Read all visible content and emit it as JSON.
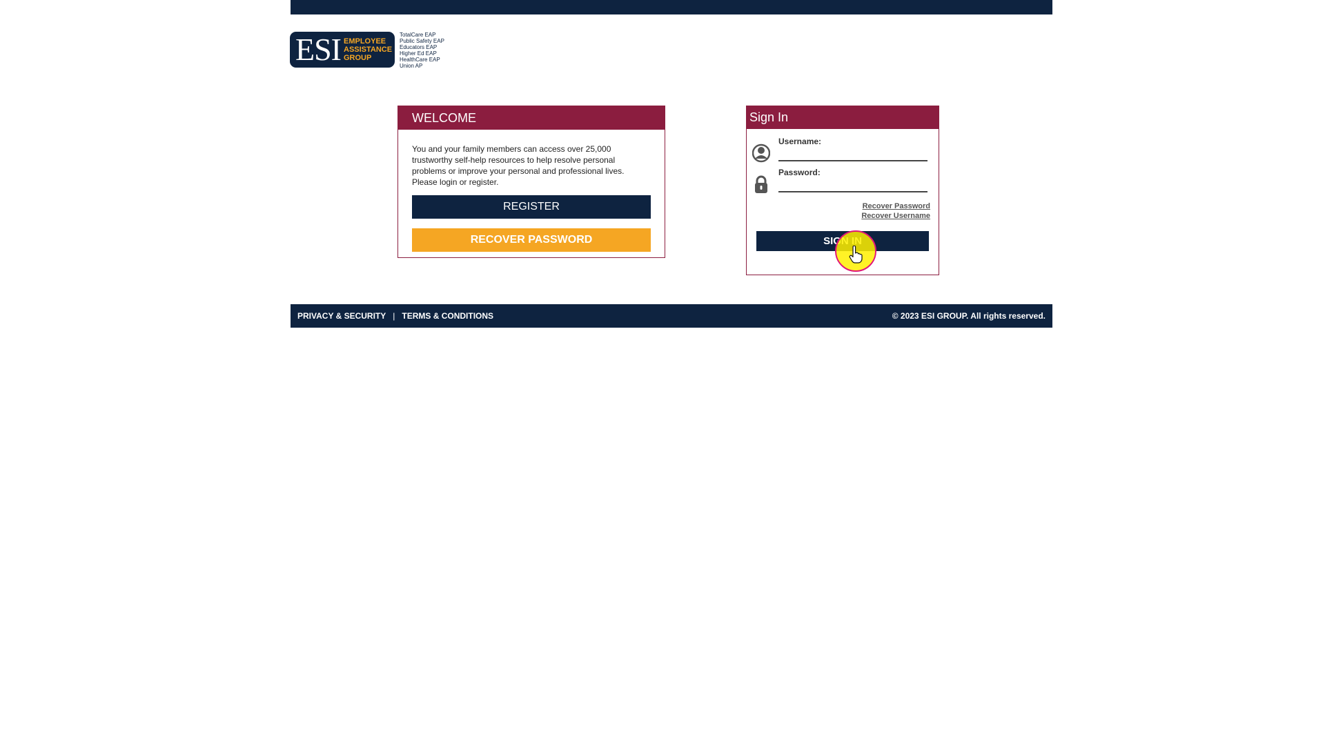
{
  "logo": {
    "main": "ESI",
    "sub_lines": [
      "EMPLOYEE",
      "ASSISTANCE",
      "GROUP"
    ],
    "programs": [
      "TotalCare EAP",
      "Public Safety EAP",
      "Educators EAP",
      "Higher Ed EAP",
      "HealthCare EAP",
      "Union AP"
    ]
  },
  "welcome": {
    "title": "WELCOME",
    "text": "You and your family members can access over 25,000 trustworthy self-help resources to help resolve personal problems or improve your personal and professional lives. Please login or register.",
    "register_label": "REGISTER",
    "recover_label": "RECOVER PASSWORD"
  },
  "signin": {
    "title": "Sign In",
    "username_label": "Username:",
    "username_value": "",
    "password_label": "Password:",
    "password_value": "",
    "recover_password_link": "Recover Password",
    "recover_username_link": "Recover Username",
    "signin_label": "SIGN IN"
  },
  "footer": {
    "privacy": "PRIVACY & SECURITY",
    "separator": "|",
    "terms": "TERMS & CONDITIONS",
    "copyright": "© 2023 ESI GROUP. All rights reserved."
  },
  "colors": {
    "navy": "#0e2340",
    "maroon": "#8b1d3f",
    "orange": "#f5a623",
    "highlight": "#fff000"
  }
}
